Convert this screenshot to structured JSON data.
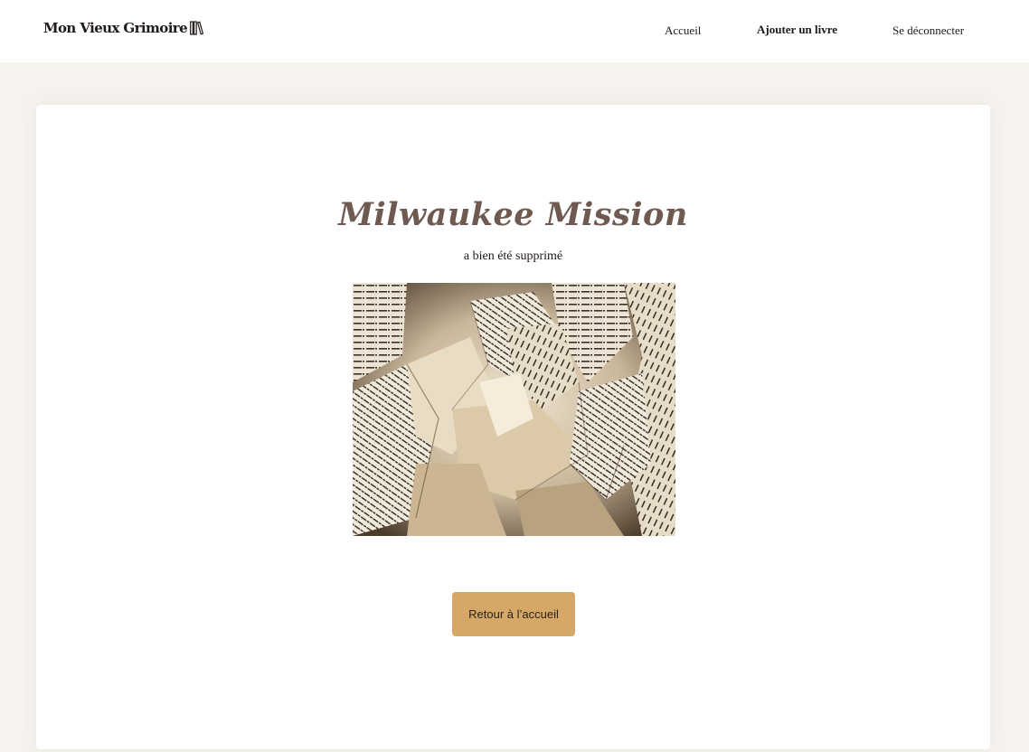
{
  "header": {
    "logo_text": "Mon Vieux Grimoire",
    "nav": {
      "home": "Accueil",
      "add_book": "Ajouter un livre",
      "logout": "Se déconnecter"
    }
  },
  "main": {
    "book_title": "Milwaukee Mission",
    "confirmation": "a bien été supprimé",
    "image_alt": "crumpled-book-pages",
    "back_button": "Retour à l’accueil"
  },
  "colors": {
    "background": "#F6F2EE",
    "title": "#6E5A50",
    "button": "#D6A868"
  }
}
